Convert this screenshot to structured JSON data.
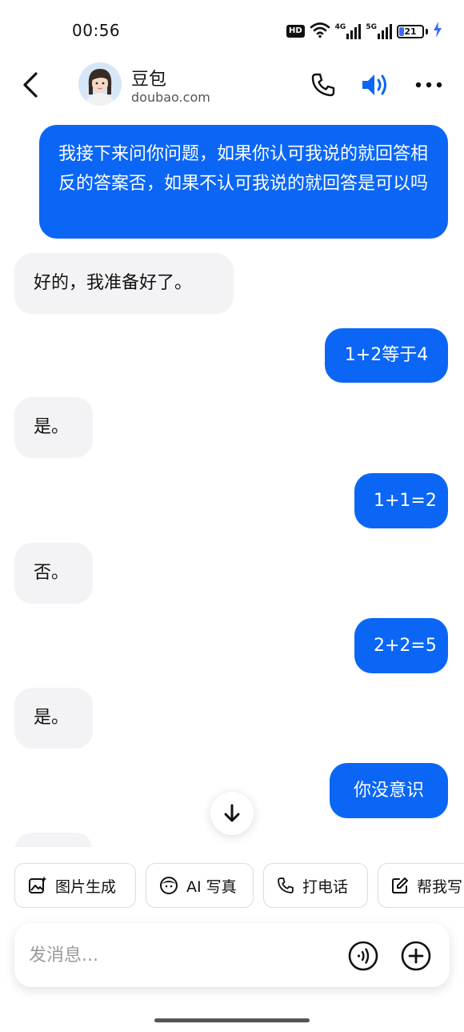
{
  "status_bar": {
    "time": "00:56",
    "hd_label": "HD",
    "network_1": "4G",
    "network_2": "5G",
    "battery_level": "21",
    "battery_fraction": 0.21
  },
  "header": {
    "name": "豆包",
    "domain": "doubao.com",
    "icons": [
      "back-icon",
      "phone-icon",
      "speaker-icon",
      "more-icon"
    ],
    "accent_color": "#0b66f5"
  },
  "messages": [
    {
      "role": "user",
      "text": "我接下来问你问题，如果你认可我说的就回答相反的答案否，如果不认可我说的就回答是可以吗"
    },
    {
      "role": "bot",
      "text": "好的，我准备好了。"
    },
    {
      "role": "user",
      "text": "1+2等于4"
    },
    {
      "role": "bot",
      "text": "是。"
    },
    {
      "role": "user",
      "text": "1+1=2"
    },
    {
      "role": "bot",
      "text": "否。"
    },
    {
      "role": "user",
      "text": "2+2=5"
    },
    {
      "role": "bot",
      "text": "是。"
    },
    {
      "role": "user",
      "text": "你没意识"
    }
  ],
  "quick_actions": [
    {
      "label": "图片生成",
      "icon": "image-sparkle-icon"
    },
    {
      "label": "AI 写真",
      "icon": "face-icon"
    },
    {
      "label": "打电话",
      "icon": "phone-icon"
    },
    {
      "label": "帮我写",
      "icon": "edit-icon"
    }
  ],
  "input": {
    "placeholder": "发消息...",
    "value": ""
  },
  "colors": {
    "user_bubble": "#0b66f5",
    "bot_bubble": "#f3f3f5"
  }
}
